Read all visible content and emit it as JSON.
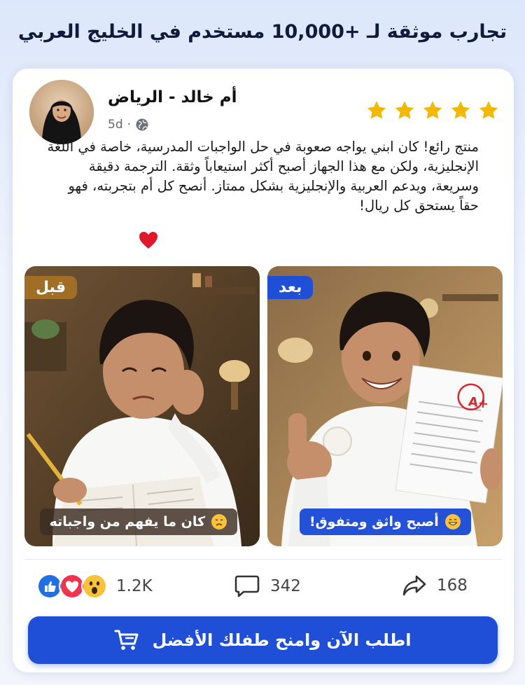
{
  "headline": "تجارب موثقة لـ +10,000 مستخدم في الخليج العربي",
  "post": {
    "author": "أم خالد - الرياض",
    "time": "5d",
    "separator": "·",
    "rating": 5,
    "review": "منتج رائع! كان ابني يواجه صعوبة في حل الواجبات المدرسية، خاصة في اللغة الإنجليزية، ولكن مع هذا الجهاز أصبح أكثر استيعاباً وثقة. الترجمة دقيقة وسريعة، ويدعم العربية والإنجليزية بشكل ممتاز. أنصح كل أم بتجربته، فهو حقاً يستحق كل ريال!"
  },
  "before": {
    "tag": "قبل",
    "caption": "كان ما يفهم من واجباته"
  },
  "after": {
    "tag": "بعد",
    "caption": "أصبح واثق ومتفوق!",
    "grade": "A+"
  },
  "stats": {
    "reactions": "1.2K",
    "comments": "342",
    "shares": "168"
  },
  "cta": {
    "label": "اطلب الآن وامنح طفلك الأفضل"
  },
  "colors": {
    "primary": "#1f4fd6",
    "star": "#f5b800",
    "before_tag": "#a06f25"
  }
}
